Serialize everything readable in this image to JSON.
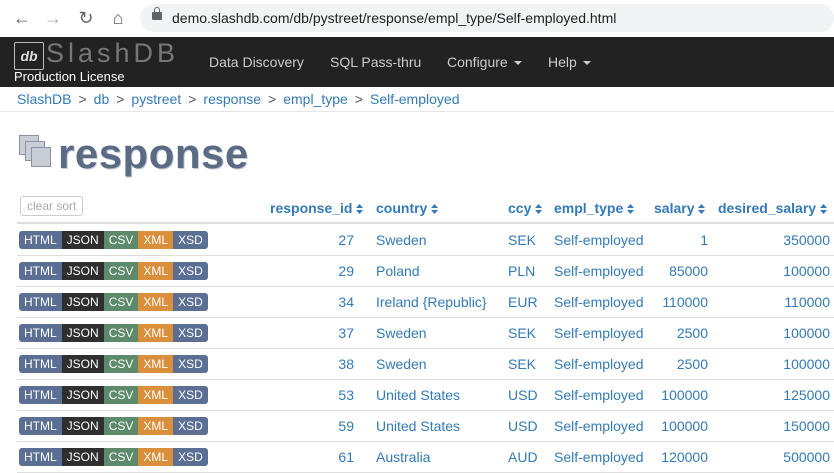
{
  "browser": {
    "url": "demo.slashdb.com/db/pystreet/response/empl_type/Self-employed.html"
  },
  "navbar": {
    "brand": "SlashDB",
    "license": "Production License",
    "items": [
      {
        "label": "Data Discovery"
      },
      {
        "label": "SQL Pass-thru"
      },
      {
        "label": "Configure"
      },
      {
        "label": "Help"
      }
    ]
  },
  "breadcrumb": [
    "SlashDB",
    "db",
    "pystreet",
    "response",
    "empl_type",
    "Self-employed"
  ],
  "page": {
    "title": "response"
  },
  "table": {
    "clear_sort": "clear sort",
    "headers": [
      "response_id",
      "country",
      "ccy",
      "empl_type",
      "salary",
      "desired_salary"
    ],
    "formats": [
      "HTML",
      "JSON",
      "CSV",
      "XML",
      "XSD"
    ],
    "rows": [
      {
        "response_id": "27",
        "country": "Sweden",
        "ccy": "SEK",
        "empl_type": "Self-employed",
        "salary": "1",
        "desired_salary": "350000"
      },
      {
        "response_id": "29",
        "country": "Poland",
        "ccy": "PLN",
        "empl_type": "Self-employed",
        "salary": "85000",
        "desired_salary": "100000"
      },
      {
        "response_id": "34",
        "country": "Ireland {Republic}",
        "ccy": "EUR",
        "empl_type": "Self-employed",
        "salary": "110000",
        "desired_salary": "110000"
      },
      {
        "response_id": "37",
        "country": "Sweden",
        "ccy": "SEK",
        "empl_type": "Self-employed",
        "salary": "2500",
        "desired_salary": "100000"
      },
      {
        "response_id": "38",
        "country": "Sweden",
        "ccy": "SEK",
        "empl_type": "Self-employed",
        "salary": "2500",
        "desired_salary": "100000"
      },
      {
        "response_id": "53",
        "country": "United States",
        "ccy": "USD",
        "empl_type": "Self-employed",
        "salary": "100000",
        "desired_salary": "125000"
      },
      {
        "response_id": "59",
        "country": "United States",
        "ccy": "USD",
        "empl_type": "Self-employed",
        "salary": "100000",
        "desired_salary": "150000"
      },
      {
        "response_id": "61",
        "country": "Australia",
        "ccy": "AUD",
        "empl_type": "Self-employed",
        "salary": "120000",
        "desired_salary": "500000"
      }
    ]
  }
}
